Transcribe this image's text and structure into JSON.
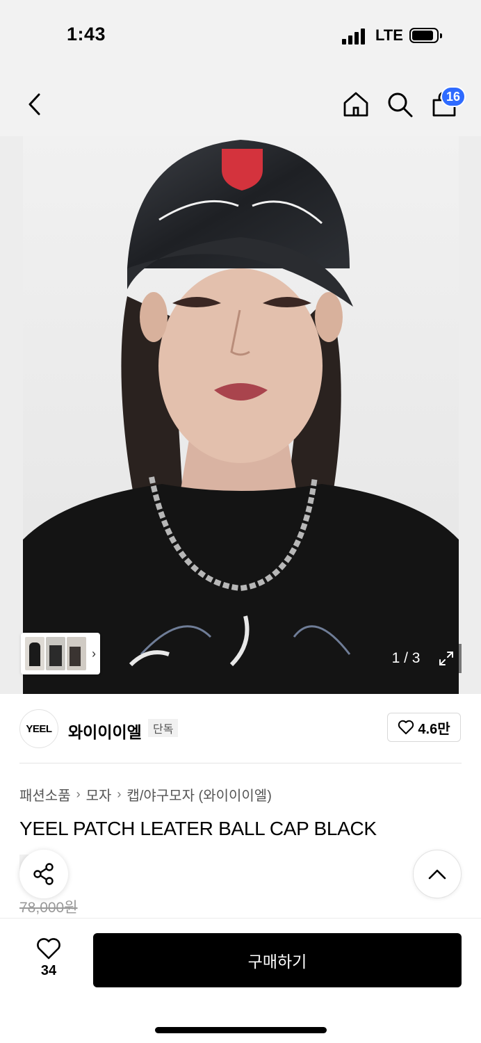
{
  "status_bar": {
    "time": "1:43",
    "network": "LTE"
  },
  "nav": {
    "back_icon": "chevron-left-icon",
    "home_icon": "home-icon",
    "search_icon": "search-icon",
    "bag_icon": "shopping-bag-icon",
    "cart_badge": "16",
    "badge_color": "#2f6bff"
  },
  "gallery": {
    "page_counter": "1 / 3",
    "expand_icon": "expand-icon"
  },
  "brand": {
    "logo_text": "YEEL",
    "name": "와이이이엘",
    "exclusive_label": "단독",
    "likes": "4.6만"
  },
  "product": {
    "breadcrumb": [
      "패션소품",
      "모자",
      "캡/야구모자 (와이이이엘)"
    ],
    "title": "YEEL PATCH LEATER BALL CAP BLACK",
    "exclusive_label": "단독",
    "original_price": "78,000원"
  },
  "bottom_bar": {
    "wish_count": "34",
    "buy_label": "구매하기"
  }
}
